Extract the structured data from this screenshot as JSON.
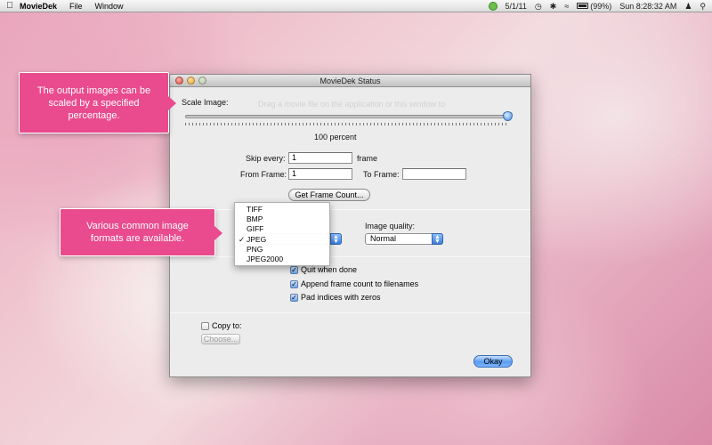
{
  "menubar": {
    "apple_icon": "apple-icon",
    "app_name": "MovieDek",
    "menus": [
      "File",
      "Window"
    ],
    "date": "5/1/11",
    "battery": "(99%)",
    "clock": "Sun 8:28:32 AM"
  },
  "window": {
    "title": "MovieDek Status",
    "scale_label": "Scale Image:",
    "scale_value_text": "100 percent",
    "scale_value": 100,
    "ghost_text": "Drag a movie file on the application or this window to",
    "skip_label": "Skip every:",
    "skip_value": "1",
    "skip_unit": "frame",
    "from_label": "From Frame:",
    "from_value": "1",
    "to_label": "To Frame:",
    "to_value": "",
    "get_frame_count_label": "Get Frame Count...",
    "image_quality_label": "Image quality:",
    "image_quality_value": "Normal",
    "format_options": [
      "TIFF",
      "BMP",
      "GIFF",
      "JPEG",
      "PNG",
      "JPEG2000"
    ],
    "format_selected": "JPEG",
    "checkboxes": [
      {
        "label": "Quit when done",
        "checked": true
      },
      {
        "label": "Append frame count to filenames",
        "checked": true
      },
      {
        "label": "Pad indices with zeros",
        "checked": true
      }
    ],
    "copy_to_label": "Copy to:",
    "choose_label": "Choose...",
    "ok_label": "Okay"
  },
  "callouts": {
    "scale": "The output images can be scaled by a specified percentage.",
    "formats": "Various common image formats are available."
  },
  "colors": {
    "callout": "#e94b8e",
    "accent_blue": "#5b9cf0"
  }
}
